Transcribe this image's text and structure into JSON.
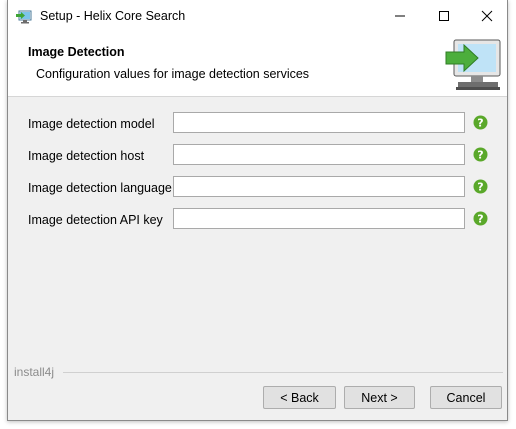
{
  "window": {
    "title": "Setup - Helix Core Search"
  },
  "header": {
    "title": "Image Detection",
    "subtitle": "Configuration values for image detection services"
  },
  "form": {
    "fields": [
      {
        "label": "Image detection model",
        "value": ""
      },
      {
        "label": "Image detection host",
        "value": ""
      },
      {
        "label": "Image detection language",
        "value": ""
      },
      {
        "label": "Image detection API key",
        "value": ""
      }
    ]
  },
  "footer": {
    "brand": "install4j"
  },
  "buttons": {
    "back": "< Back",
    "next": "Next >",
    "cancel": "Cancel"
  },
  "colors": {
    "help_icon": "#5aa82a",
    "accent_arrow": "#4cae3c",
    "monitor_screen": "#4aa3df"
  },
  "icons": {
    "app": "setup-computer-icon",
    "header": "monitor-arrow-icon",
    "help": "question-help-icon"
  }
}
